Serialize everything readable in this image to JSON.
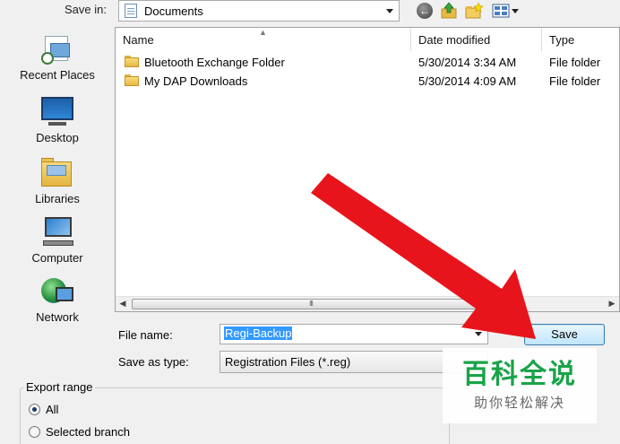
{
  "toolbar": {
    "save_in_label": "Save in:",
    "location": "Documents"
  },
  "places": [
    {
      "label": "Recent Places"
    },
    {
      "label": "Desktop"
    },
    {
      "label": "Libraries"
    },
    {
      "label": "Computer"
    },
    {
      "label": "Network"
    }
  ],
  "file_list": {
    "columns": [
      "Name",
      "Date modified",
      "Type"
    ],
    "rows": [
      {
        "name": "Bluetooth Exchange Folder",
        "date": "5/30/2014 3:34 AM",
        "type": "File folder"
      },
      {
        "name": "My DAP Downloads",
        "date": "5/30/2014 4:09 AM",
        "type": "File folder"
      }
    ],
    "scroll_thumb_grip": "III"
  },
  "form": {
    "file_name_label": "File name:",
    "file_name_value": "Regi-Backup",
    "save_as_type_label": "Save as type:",
    "save_as_type_value": "Registration Files (*.reg)",
    "save_label": "Save"
  },
  "export_range": {
    "title": "Export range",
    "options": [
      {
        "label": "All",
        "selected": true
      },
      {
        "label": "Selected branch",
        "selected": false
      }
    ]
  },
  "watermark": {
    "title": "百科全说",
    "subtitle": "助你轻松解决"
  },
  "colors": {
    "arrow": "#e8141b",
    "selection": "#3399ff",
    "watermark_green": "#19a349"
  },
  "icons": [
    "back-icon",
    "up-folder-icon",
    "new-folder-icon",
    "views-menu-icon",
    "folder-icon",
    "documents-icon"
  ]
}
